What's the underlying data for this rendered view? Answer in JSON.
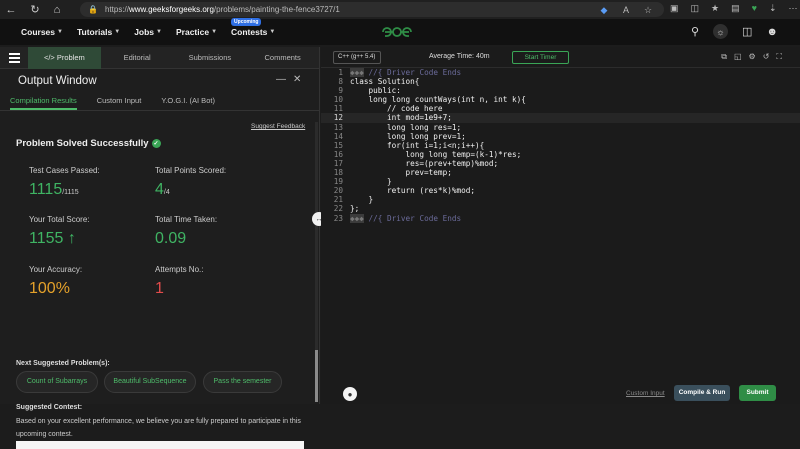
{
  "browser": {
    "url_prefix": "https://",
    "url_host": "www.geeksforgeeks.org",
    "url_path": "/problems/painting-the-fence3727/1"
  },
  "nav": {
    "items": [
      {
        "label": "Courses"
      },
      {
        "label": "Tutorials"
      },
      {
        "label": "Jobs"
      },
      {
        "label": "Practice"
      },
      {
        "label": "Contests"
      }
    ],
    "badge": "Upcoming"
  },
  "left": {
    "tabs": [
      "</> Problem",
      "Editorial",
      "Submissions",
      "Comments"
    ],
    "output_title": "Output Window",
    "sub_tabs": [
      "Compilation Results",
      "Custom Input",
      "Y.O.G.I. (AI Bot)"
    ],
    "suggest_feedback": "Suggest Feedback",
    "solved": "Problem Solved Successfully",
    "stats": {
      "tc_label": "Test Cases Passed:",
      "tc_value": "1115",
      "tc_total": "/1115",
      "pts_label": "Total Points Scored:",
      "pts_value": "4",
      "pts_total": "/4",
      "score_label": "Your Total Score:",
      "score_value": "1155",
      "time_label": "Total Time Taken:",
      "time_value": "0.09",
      "acc_label": "Your Accuracy:",
      "acc_value": "100%",
      "att_label": "Attempts No.:",
      "att_value": "1"
    },
    "next_title": "Next Suggested Problem(s):",
    "chips": [
      "Count of Subarrays",
      "Beautiful SubSequence",
      "Pass the semester"
    ],
    "contest_title": "Suggested Contest:",
    "contest_text": "Based on your excellent performance, we believe you are fully prepared to participate in this upcoming contest."
  },
  "editor": {
    "language": "C++ (g++ 5.4)",
    "avg_time": "Average Time: 40m",
    "start_timer": "Start Timer",
    "custom_input": "Custom Input",
    "compile": "Compile & Run",
    "submit": "Submit",
    "lines": [
      {
        "n": "1",
        "code": "//{ Driver Code Ends"
      },
      {
        "n": "8",
        "code": "class Solution{"
      },
      {
        "n": "9",
        "code": "    public:"
      },
      {
        "n": "10",
        "code": "    long long countWays(int n, int k){"
      },
      {
        "n": "11",
        "code": "        // code here"
      },
      {
        "n": "12",
        "code": "        int mod=1e9+7;"
      },
      {
        "n": "13",
        "code": "        long long res=1;"
      },
      {
        "n": "14",
        "code": "        long long prev=1;"
      },
      {
        "n": "15",
        "code": "        for(int i=1;i<n;i++){"
      },
      {
        "n": "16",
        "code": "            long long temp=(k-1)*res;"
      },
      {
        "n": "17",
        "code": "            res=(prev+temp)%mod;"
      },
      {
        "n": "18",
        "code": "            prev=temp;"
      },
      {
        "n": "19",
        "code": "        }"
      },
      {
        "n": "20",
        "code": "        return (res*k)%mod;"
      },
      {
        "n": "21",
        "code": "    }"
      },
      {
        "n": "22",
        "code": "};"
      },
      {
        "n": "23",
        "code": "//{ Driver Code Ends"
      }
    ]
  }
}
